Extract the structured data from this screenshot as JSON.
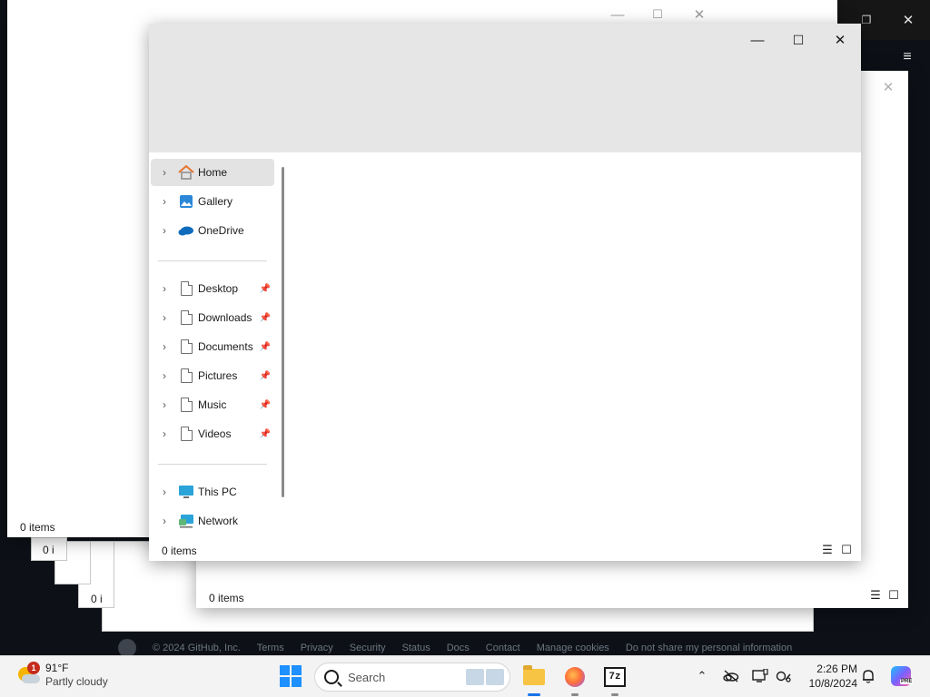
{
  "main_window": {
    "status": "0 items",
    "nav_items": [
      {
        "label": "Home",
        "icon": "home-icon",
        "pinned": false
      },
      {
        "label": "Gallery",
        "icon": "gallery-icon",
        "pinned": false
      },
      {
        "label": "OneDrive",
        "icon": "onedrive-icon",
        "pinned": false
      },
      {
        "label": "Desktop",
        "icon": "file-icon",
        "pinned": true
      },
      {
        "label": "Downloads",
        "icon": "file-icon",
        "pinned": true
      },
      {
        "label": "Documents",
        "icon": "file-icon",
        "pinned": true
      },
      {
        "label": "Pictures",
        "icon": "file-icon",
        "pinned": true
      },
      {
        "label": "Music",
        "icon": "file-icon",
        "pinned": true
      },
      {
        "label": "Videos",
        "icon": "file-icon",
        "pinned": true
      },
      {
        "label": "This PC",
        "icon": "this-pc-icon",
        "pinned": false
      },
      {
        "label": "Network",
        "icon": "network-icon",
        "pinned": false
      }
    ]
  },
  "back_window": {
    "status": "0 items"
  },
  "lower_window": {
    "status": "0 items"
  },
  "stub_labels": {
    "a": "0 i",
    "b": "0 i"
  },
  "github_footer": {
    "copyright": "© 2024 GitHub, Inc.",
    "links": [
      "Terms",
      "Privacy",
      "Security",
      "Status",
      "Docs",
      "Contact",
      "Manage cookies",
      "Do not share my personal information"
    ]
  },
  "taskbar": {
    "weather_temp": "91°F",
    "weather_desc": "Partly cloudy",
    "weather_badge": "1",
    "search_label": "Search",
    "sevenzip_label": "7z",
    "clock_time": "2:26 PM",
    "clock_date": "10/8/2024",
    "copilot_badge": "PRE"
  },
  "colors": {
    "accent": "#1e90ff",
    "folder": "#f7c543",
    "onedrive": "#0f6cbd"
  }
}
